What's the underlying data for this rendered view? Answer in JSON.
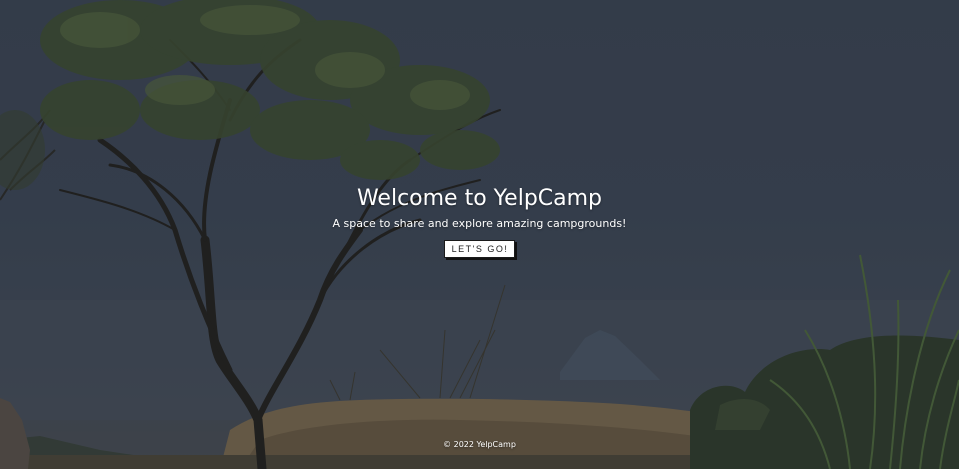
{
  "hero": {
    "title": "Welcome to YelpCamp",
    "subtitle": "A space to share and explore amazing campgrounds!",
    "cta_label": "LET'S GO!"
  },
  "footer": {
    "copyright": "© 2022 YelpCamp"
  },
  "colors": {
    "sky": "#3d4654",
    "text": "#ffffff",
    "button_bg": "#ffffff",
    "button_text": "#222222"
  }
}
